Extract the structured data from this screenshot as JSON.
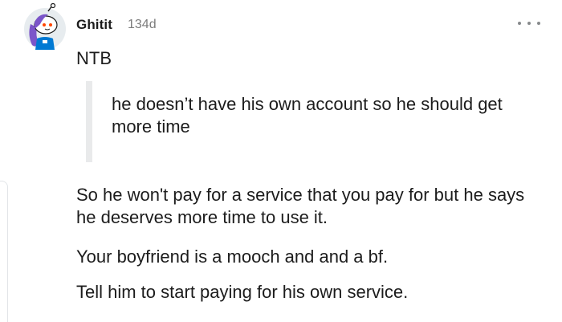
{
  "comment": {
    "author": "Ghitit",
    "age": "134d",
    "avatar_icon": "snoo-avatar-icon",
    "more_icon": "more-options-icon",
    "first_line": "NTB",
    "quote": "he doesn’t have his own account so he should get more time",
    "paragraphs": [
      "So he won't pay for a service that you pay for but he says he deserves more time to use it.",
      "Your boyfriend is a mooch and and a bf.",
      "Tell him to start paying for his own service."
    ]
  },
  "colors": {
    "text": "#1c1c1c",
    "muted": "#7c7c7c",
    "quote_bar": "#e9eaeb",
    "avatar_hair": "#7b55c9",
    "avatar_shirt": "#0079d3"
  }
}
